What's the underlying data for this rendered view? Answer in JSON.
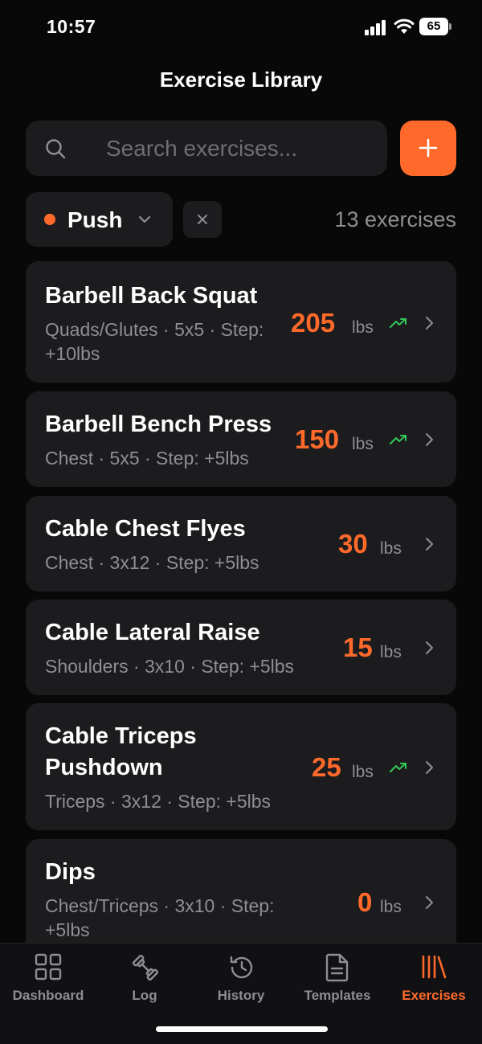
{
  "status": {
    "time": "10:57",
    "battery": "65"
  },
  "header": {
    "title": "Exercise Library"
  },
  "search": {
    "placeholder": "Search exercises..."
  },
  "filter": {
    "label": "Push",
    "count": "13 exercises",
    "accent": "#ff6a2b"
  },
  "exercises": [
    {
      "name": "Barbell Back Squat",
      "meta": "Quads/Glutes · 5x5 · Step: +10lbs",
      "weight": "205",
      "unit": "lbs",
      "trend": true
    },
    {
      "name": "Barbell Bench Press",
      "meta": "Chest · 5x5 · Step: +5lbs",
      "weight": "150",
      "unit": "lbs",
      "trend": true
    },
    {
      "name": "Cable Chest Flyes",
      "meta": "Chest · 3x12 · Step: +5lbs",
      "weight": "30",
      "unit": "lbs",
      "trend": false
    },
    {
      "name": "Cable Lateral Raise",
      "meta": "Shoulders · 3x10 · Step: +5lbs",
      "weight": "15",
      "unit": "lbs",
      "trend": false
    },
    {
      "name": "Cable Triceps Pushdown",
      "meta": "Triceps · 3x12 · Step: +5lbs",
      "weight": "25",
      "unit": "lbs",
      "trend": true
    },
    {
      "name": "Dips",
      "meta": "Chest/Triceps · 3x10 · Step: +5lbs",
      "weight": "0",
      "unit": "lbs",
      "trend": false
    }
  ],
  "tabs": [
    {
      "label": "Dashboard",
      "icon": "grid-icon"
    },
    {
      "label": "Log",
      "icon": "dumbbell-icon"
    },
    {
      "label": "History",
      "icon": "history-icon"
    },
    {
      "label": "Templates",
      "icon": "document-icon"
    },
    {
      "label": "Exercises",
      "icon": "library-icon",
      "active": true
    }
  ]
}
